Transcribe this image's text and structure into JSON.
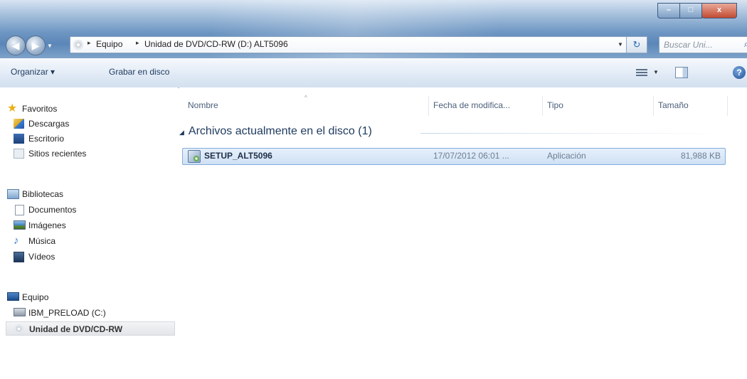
{
  "window": {
    "minimize_glyph": "–",
    "maximize_glyph": "□",
    "close_glyph": "x"
  },
  "address_bar": {
    "breadcrumbs": [
      "Equipo",
      "Unidad de DVD/CD-RW (D:) ALT5096"
    ],
    "separator_glyph": "▸",
    "back_glyph": "◀",
    "forward_glyph": "▶",
    "dropdown_glyph": "▼",
    "refresh_glyph": "↻",
    "search_placeholder": "Buscar Uni...",
    "search_icon_glyph": "⌕"
  },
  "command_bar": {
    "organize_label": "Organizar ▾",
    "burn_label": "Grabar en disco",
    "views_dropdown_glyph": "▼",
    "help_glyph": "?"
  },
  "nav_pane": {
    "favorites_label": "Favoritos",
    "favorites_items": [
      "Descargas",
      "Escritorio",
      "Sitios recientes"
    ],
    "libraries_label": "Bibliotecas",
    "libraries_items": [
      "Documentos",
      "Imágenes",
      "Música",
      "Vídeos"
    ],
    "computer_label": "Equipo",
    "computer_items": [
      "IBM_PRELOAD (C:)",
      "Unidad de DVD/CD-RW"
    ],
    "selected_item": "Unidad de DVD/CD-RW",
    "star_glyph": "★",
    "music_glyph": "♪"
  },
  "file_list": {
    "columns": [
      "Nombre",
      "Fecha de modifica...",
      "Tipo",
      "Tamaño"
    ],
    "sort_arrow_glyph": "^",
    "group_arrow_glyph": "◢",
    "group_header": "Archivos actualmente en el disco (1)",
    "rows": [
      {
        "name": "SETUP_ALT5096",
        "date": "17/07/2012 06:01 ...",
        "type": "Aplicación",
        "size": "81,988 KB"
      }
    ]
  },
  "colors": {
    "accent": "#5b86b8",
    "selection_border": "#84acdd",
    "close_button": "#c24b31"
  }
}
